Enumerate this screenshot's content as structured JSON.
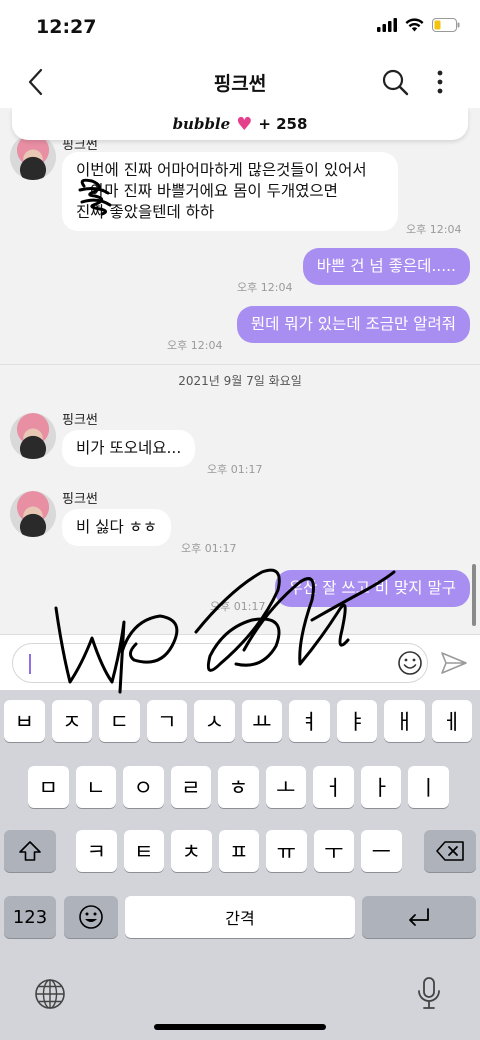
{
  "status_bar": {
    "time": "12:27"
  },
  "header": {
    "title": "핑크썬"
  },
  "banner": {
    "brand": "bubble",
    "count_text": "+ 258"
  },
  "messages": {
    "m1_sender_partial": "핑크썬",
    "m1_line1": "이번에 진짜 어마어마하게 많은것들이 있어서",
    "m1_line2": "아마 진짜 바쁠거에요 몸이 두개였으면",
    "m1_line3": "진짜 좋았을텐데 하하",
    "m1_time": "오후 12:04",
    "o1_text": "바쁜 건 넘 좋은데.....",
    "o1_time": "오후 12:04",
    "o2_text": "뭔데 뭐가 있는데 조금만 알려줘",
    "o2_time": "오후 12:04",
    "date_separator": "2021년 9월 7일 화요일",
    "m2_sender": "핑크썬",
    "m2_text": "비가 또오네요...",
    "m2_time": "오후 01:17",
    "m3_sender": "핑크썬",
    "m3_text": "비 싫다 ㅎㅎ",
    "m3_time": "오후 01:17",
    "o3_text": "우산 잘 쓰고 비 맞지 말구",
    "o3_time": "오후 01:17"
  },
  "keyboard": {
    "row1": [
      "ㅂ",
      "ㅈ",
      "ㄷ",
      "ㄱ",
      "ㅅ",
      "ㅛ",
      "ㅕ",
      "ㅑ",
      "ㅐ",
      "ㅔ"
    ],
    "row2": [
      "ㅁ",
      "ㄴ",
      "ㅇ",
      "ㄹ",
      "ㅎ",
      "ㅗ",
      "ㅓ",
      "ㅏ",
      "ㅣ"
    ],
    "row3": [
      "ㅋ",
      "ㅌ",
      "ㅊ",
      "ㅍ",
      "ㅠ",
      "ㅜ",
      "ㅡ"
    ],
    "numbers_key": "123",
    "space_key": "간격"
  },
  "colors": {
    "outgoing_bubble": "#a88ef0",
    "chat_background": "#f2f2f2",
    "keyboard_background": "#d2d4d9",
    "heart": "#e4418c"
  },
  "icons": [
    "back-icon",
    "search-icon",
    "more-icon",
    "heart-icon",
    "emoji-icon",
    "send-icon",
    "shift-icon",
    "backspace-icon",
    "emoji-keyboard-icon",
    "return-icon",
    "globe-icon",
    "microphone-icon",
    "signal-icon",
    "wifi-icon",
    "battery-icon"
  ]
}
